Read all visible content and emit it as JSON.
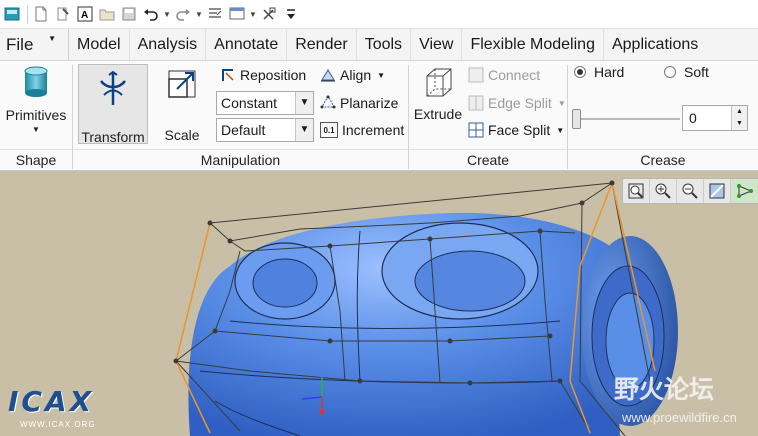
{
  "quick_access": {
    "icons": [
      "app-icon",
      "new-icon",
      "regenerate-icon",
      "model-icon",
      "open-icon",
      "save-icon",
      "undo-icon",
      "redo-icon",
      "regen-tree-icon",
      "window-icon",
      "close-window-icon",
      "customize-icon"
    ]
  },
  "tabs": {
    "file": "File",
    "items": [
      "Model",
      "Analysis",
      "Annotate",
      "Render",
      "Tools",
      "View",
      "Flexible Modeling",
      "Applications"
    ]
  },
  "ribbon": {
    "shape": {
      "label": "Shape",
      "primitives": "Primitives"
    },
    "manipulation": {
      "label": "Manipulation",
      "transform": "Transform",
      "scale": "Scale",
      "reposition": "Reposition",
      "align": "Align",
      "planarize": "Planarize",
      "increment": "Increment",
      "select1": "Constant",
      "select2": "Default"
    },
    "create": {
      "label": "Create",
      "extrude": "Extrude",
      "connect": "Connect",
      "edge_split": "Edge Split",
      "face_split": "Face Split"
    },
    "crease": {
      "label": "Crease",
      "hard": "Hard",
      "soft": "Soft",
      "value": "0",
      "selected": "Hard"
    }
  },
  "viewport": {
    "background": "#c9bfa7",
    "model_color": "#5a8fe8",
    "cage_color": "#3a3a3a",
    "highlight_color": "#e8962e",
    "view_tools": [
      "zoom-fit-icon",
      "zoom-in-icon",
      "zoom-out-icon",
      "repaint-icon",
      "mesh-display-icon"
    ],
    "watermark_left": "ICAX",
    "watermark_left_sub": "WWW.ICAX.ORG",
    "watermark_right": "野火论坛",
    "watermark_right_sub": "www.proewildfire.cn"
  }
}
